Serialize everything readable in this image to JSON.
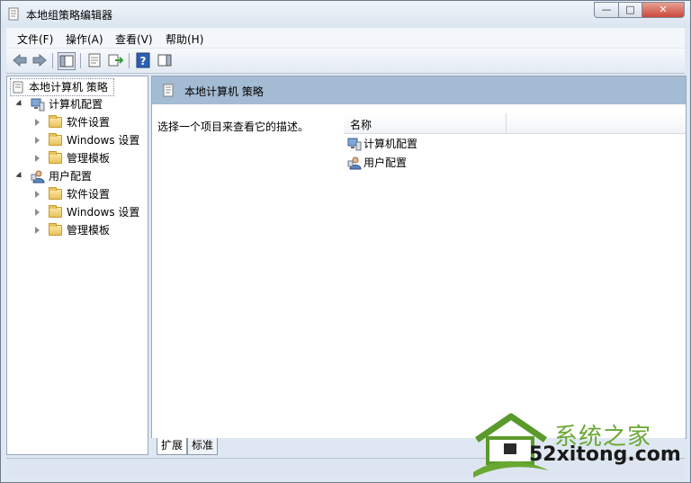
{
  "window": {
    "title": "本地组策略编辑器",
    "controls": {
      "minimize": "—",
      "maximize": "□",
      "close": "✕"
    }
  },
  "menu": [
    "文件(F)",
    "操作(A)",
    "查看(V)",
    "帮助(H)"
  ],
  "toolbar": {
    "buttons": [
      "back-icon",
      "forward-icon",
      "show-hide-tree-icon",
      "properties-icon",
      "export-icon",
      "help-icon",
      "show-hide-action-pane-icon"
    ]
  },
  "tree": {
    "root": "本地计算机 策略",
    "nodes": [
      {
        "label": "计算机配置",
        "children": [
          "软件设置",
          "Windows 设置",
          "管理模板"
        ]
      },
      {
        "label": "用户配置",
        "children": [
          "软件设置",
          "Windows 设置",
          "管理模板"
        ]
      }
    ]
  },
  "main": {
    "header": "本地计算机 策略",
    "description": "选择一个项目来查看它的描述。",
    "column": "名称",
    "items": [
      "计算机配置",
      "用户配置"
    ]
  },
  "tabs": [
    "扩展",
    "标准"
  ],
  "watermark": {
    "line1": "系统之家",
    "line2": "52xitong.com"
  },
  "colors": {
    "header_band": "#a3bbd3",
    "accent_green": "#6aa833"
  }
}
